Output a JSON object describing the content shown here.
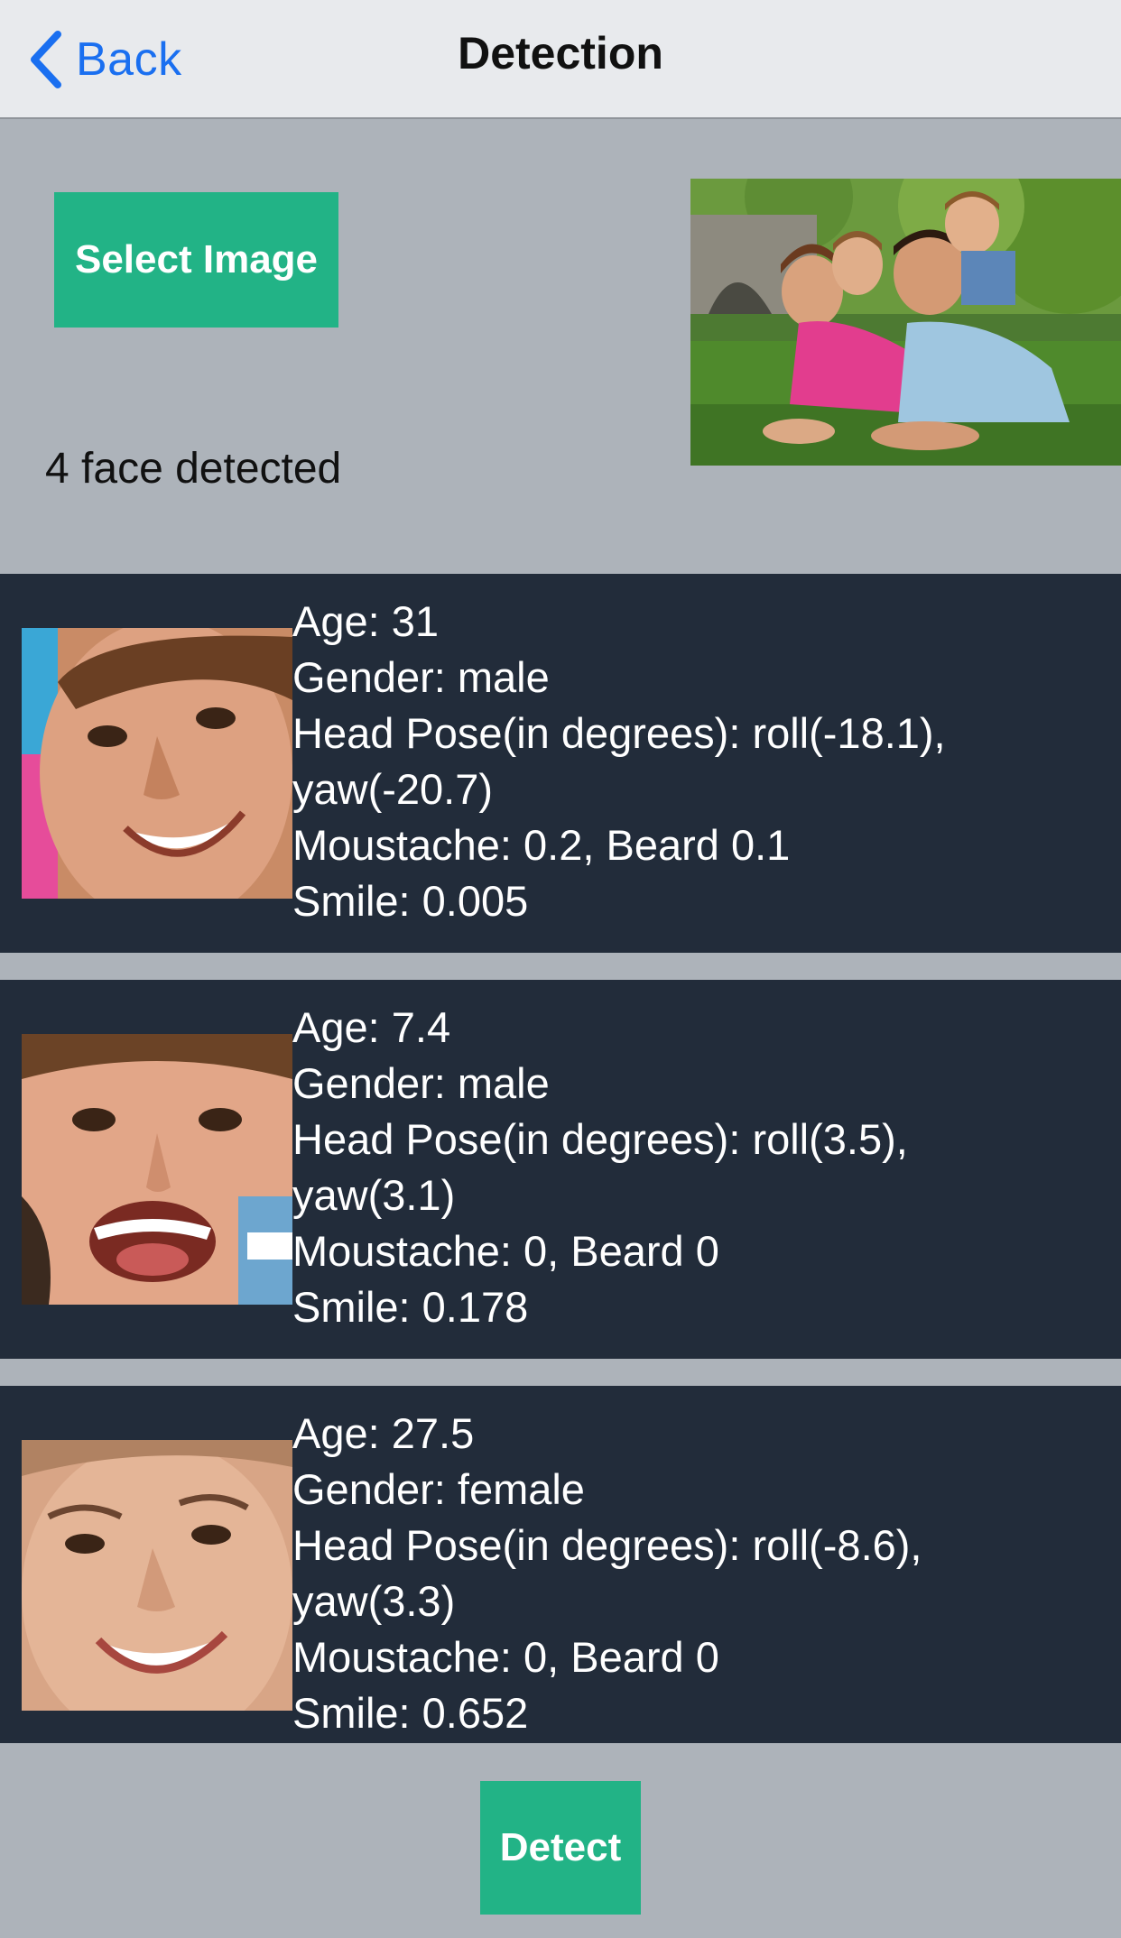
{
  "nav": {
    "back_label": "Back",
    "title": "Detection"
  },
  "top_panel": {
    "select_button_label": "Select Image",
    "faces_count_text": "4 face detected"
  },
  "faces": [
    {
      "age": "Age: 31",
      "gender": "Gender: male",
      "pose_line1": "Head Pose(in degrees): roll(-18.1),",
      "pose_line2": "yaw(-20.7)",
      "hair": "Moustache: 0.2, Beard 0.1",
      "smile": "Smile: 0.005"
    },
    {
      "age": "Age: 7.4",
      "gender": "Gender: male",
      "pose_line1": "Head Pose(in degrees): roll(3.5),",
      "pose_line2": "yaw(3.1)",
      "hair": "Moustache: 0, Beard 0",
      "smile": "Smile: 0.178"
    },
    {
      "age": "Age: 27.5",
      "gender": "Gender: female",
      "pose_line1": "Head Pose(in degrees): roll(-8.6),",
      "pose_line2": "yaw(3.3)",
      "hair": "Moustache: 0, Beard 0",
      "smile": "Smile: 0.652"
    }
  ],
  "bottom": {
    "detect_button_label": "Detect"
  },
  "colors": {
    "accent_green": "#22b386",
    "link_blue": "#1a6ff0",
    "card_bg": "#222c3a",
    "page_bg": "#adb3ba",
    "nav_bg": "#e8eaed"
  },
  "icons": {
    "back": "chevron-left-icon"
  }
}
